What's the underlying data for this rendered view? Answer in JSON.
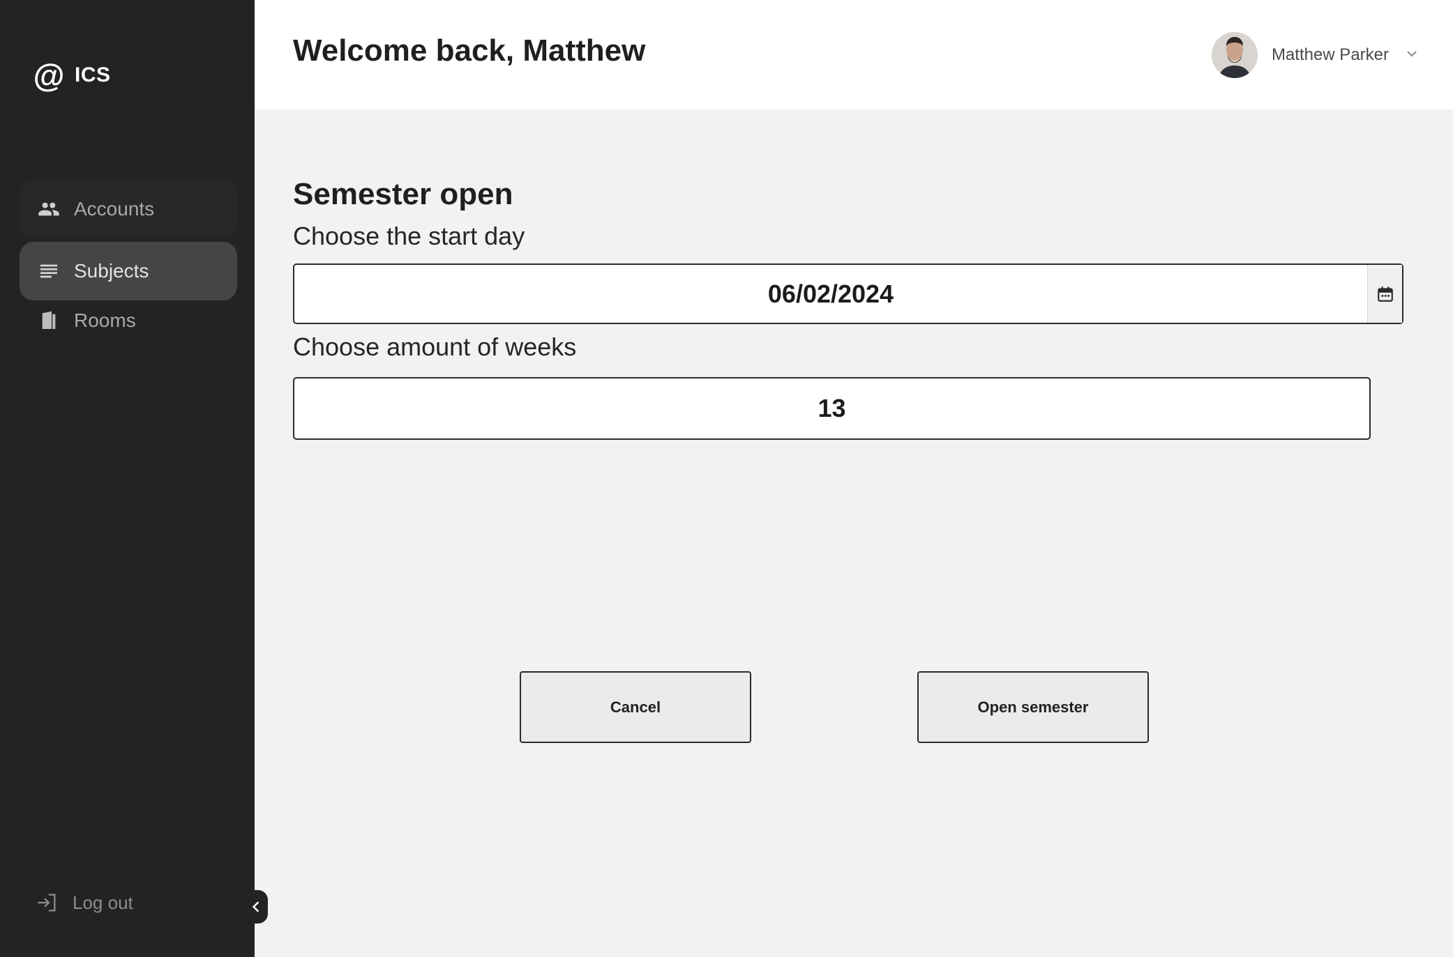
{
  "brand": {
    "logo_mark": "@",
    "name": "ICS"
  },
  "sidebar": {
    "items": [
      {
        "label": "Accounts",
        "icon": "people-icon",
        "active": false
      },
      {
        "label": "Subjects",
        "icon": "list-lines-icon",
        "active": true
      },
      {
        "label": "Rooms",
        "icon": "door-icon",
        "active": false
      }
    ],
    "logout_label": "Log out"
  },
  "header": {
    "welcome": "Welcome back, Matthew",
    "user_name": "Matthew Parker"
  },
  "form": {
    "title": "Semester open",
    "start_label": "Choose the start day",
    "start_value": "06/02/2024",
    "weeks_label": "Choose amount of weeks",
    "weeks_value": "13"
  },
  "actions": {
    "cancel_label": "Cancel",
    "open_label": "Open semester"
  },
  "colors": {
    "sidebar_bg": "#222325",
    "active_item_bg": "#444547",
    "page_bg": "#f2f2f2",
    "header_bg": "#ffffff"
  }
}
